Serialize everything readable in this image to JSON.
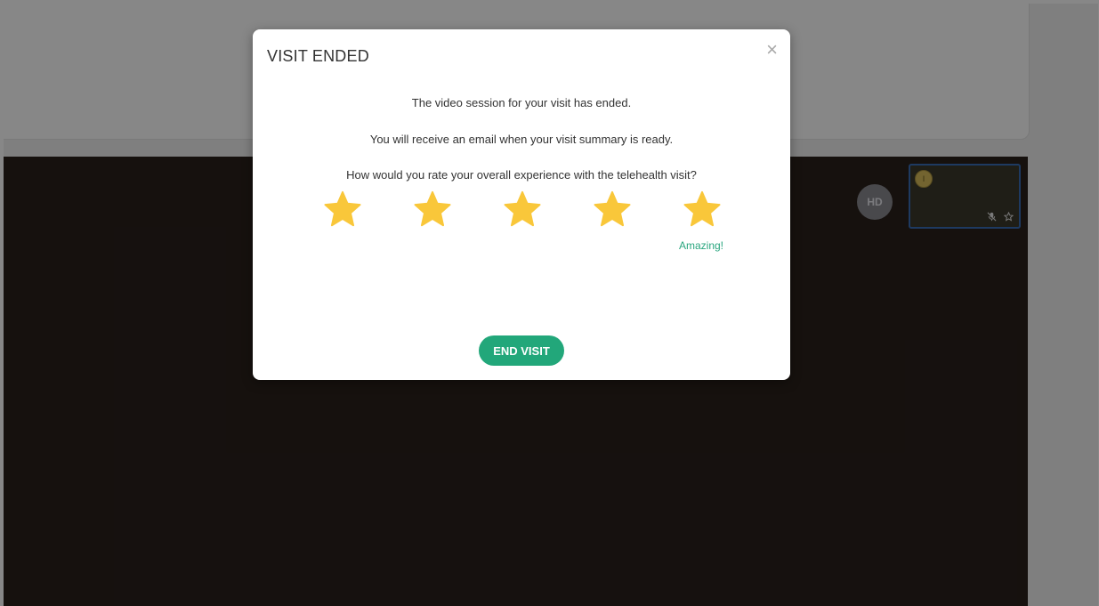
{
  "background": {
    "hd_badge": "HD",
    "self_view": {
      "avatar_initial": "I",
      "icons": [
        "mic-off-icon",
        "star-icon"
      ]
    }
  },
  "modal": {
    "title": "VISIT ENDED",
    "close_glyph": "×",
    "message_session_ended": "The video session for your visit has ended.",
    "message_email": "You will receive an email when your visit summary is ready.",
    "rating_question": "How would you rate your overall experience with the telehealth visit?",
    "rating": {
      "value": 5,
      "max": 5,
      "selected_label": "Amazing!"
    },
    "end_button_label": "END VISIT"
  },
  "colors": {
    "accent_green": "#22a77a",
    "star_yellow": "#f9c73a",
    "label_green": "#2aa67f"
  }
}
